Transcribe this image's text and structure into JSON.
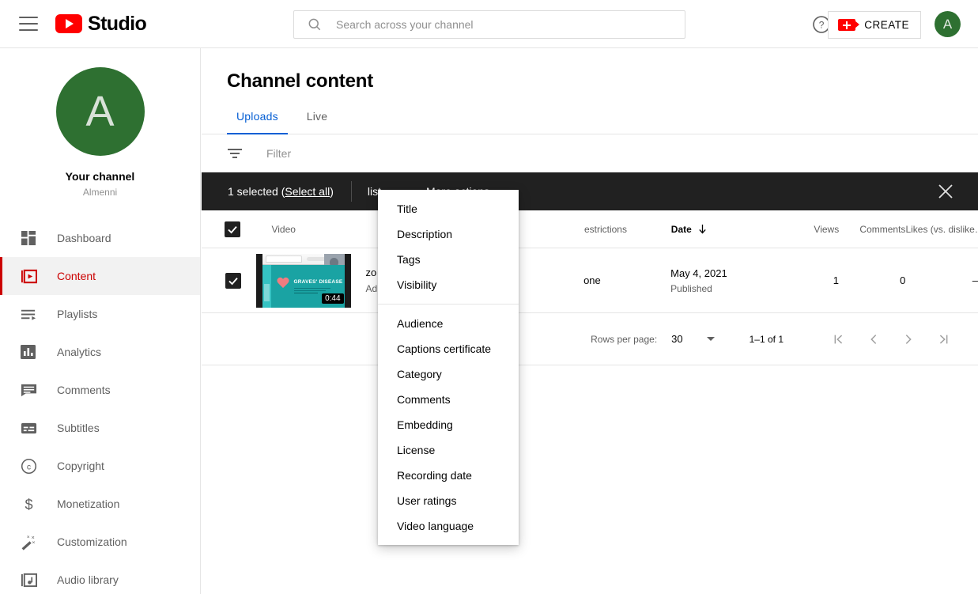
{
  "header": {
    "menu_icon": "hamburger-icon",
    "brand": "Studio",
    "search": {
      "placeholder": "Search across your channel",
      "value": ""
    },
    "help_icon": "help-circle-icon",
    "create_label": "CREATE",
    "create_icon": "video-plus-icon",
    "avatar_letter": "A",
    "avatar_color": "#2e7031"
  },
  "sidebar": {
    "avatar_letter": "A",
    "channel_label": "Your channel",
    "channel_name": "Almenni",
    "items": [
      {
        "label": "Dashboard",
        "icon": "dashboard-icon",
        "active": false
      },
      {
        "label": "Content",
        "icon": "content-icon",
        "active": true
      },
      {
        "label": "Playlists",
        "icon": "playlists-icon",
        "active": false
      },
      {
        "label": "Analytics",
        "icon": "analytics-icon",
        "active": false
      },
      {
        "label": "Comments",
        "icon": "comments-icon",
        "active": false
      },
      {
        "label": "Subtitles",
        "icon": "subtitles-icon",
        "active": false
      },
      {
        "label": "Copyright",
        "icon": "copyright-icon",
        "active": false
      },
      {
        "label": "Monetization",
        "icon": "dollar-icon",
        "active": false
      },
      {
        "label": "Customization",
        "icon": "magic-wand-icon",
        "active": false
      },
      {
        "label": "Audio library",
        "icon": "audio-library-icon",
        "active": false
      }
    ],
    "active_color": "#cc0000"
  },
  "main": {
    "title": "Channel content",
    "tabs": [
      {
        "label": "Uploads",
        "active": true
      },
      {
        "label": "Live",
        "active": false
      }
    ],
    "tab_active_color": "#065fd4",
    "filter": {
      "icon": "filter-icon",
      "placeholder": "Filter"
    }
  },
  "selection_toolbar": {
    "count_text": "1 selected (",
    "select_all": "Select all",
    "count_tail": ")",
    "playlist_action": "list",
    "more_actions": "More actions",
    "close_icon": "close-icon",
    "background": "#212121"
  },
  "menu": {
    "groups": [
      {
        "items": [
          "Title",
          "Description",
          "Tags",
          "Visibility"
        ]
      },
      {
        "items": [
          "Audience",
          "Captions certificate",
          "Category",
          "Comments",
          "Embedding",
          "License",
          "Recording date",
          "User ratings",
          "Video language"
        ]
      }
    ]
  },
  "table": {
    "headers": {
      "video": "Video",
      "restrictions": "estrictions",
      "date": "Date",
      "views": "Views",
      "comments": "Comments",
      "likes": "Likes (vs. dislike…"
    },
    "sort": {
      "column": "Date",
      "direction": "down"
    },
    "rows": [
      {
        "selected": true,
        "thumbnail": {
          "slide_title": "GRAVES' DISEASE",
          "duration": "0:44",
          "accent": "#1aa3a3"
        },
        "title": "zo",
        "description": "Ad",
        "restrictions": "one",
        "date": "May 4, 2021",
        "status": "Published",
        "views": "1",
        "comments": "0",
        "likes": "–"
      }
    ]
  },
  "pagination": {
    "rows_label": "Rows per page:",
    "rows_value": "30",
    "range": "1–1 of 1",
    "first_icon": "first-page-icon",
    "prev_icon": "prev-page-icon",
    "next_icon": "next-page-icon",
    "last_icon": "last-page-icon"
  }
}
